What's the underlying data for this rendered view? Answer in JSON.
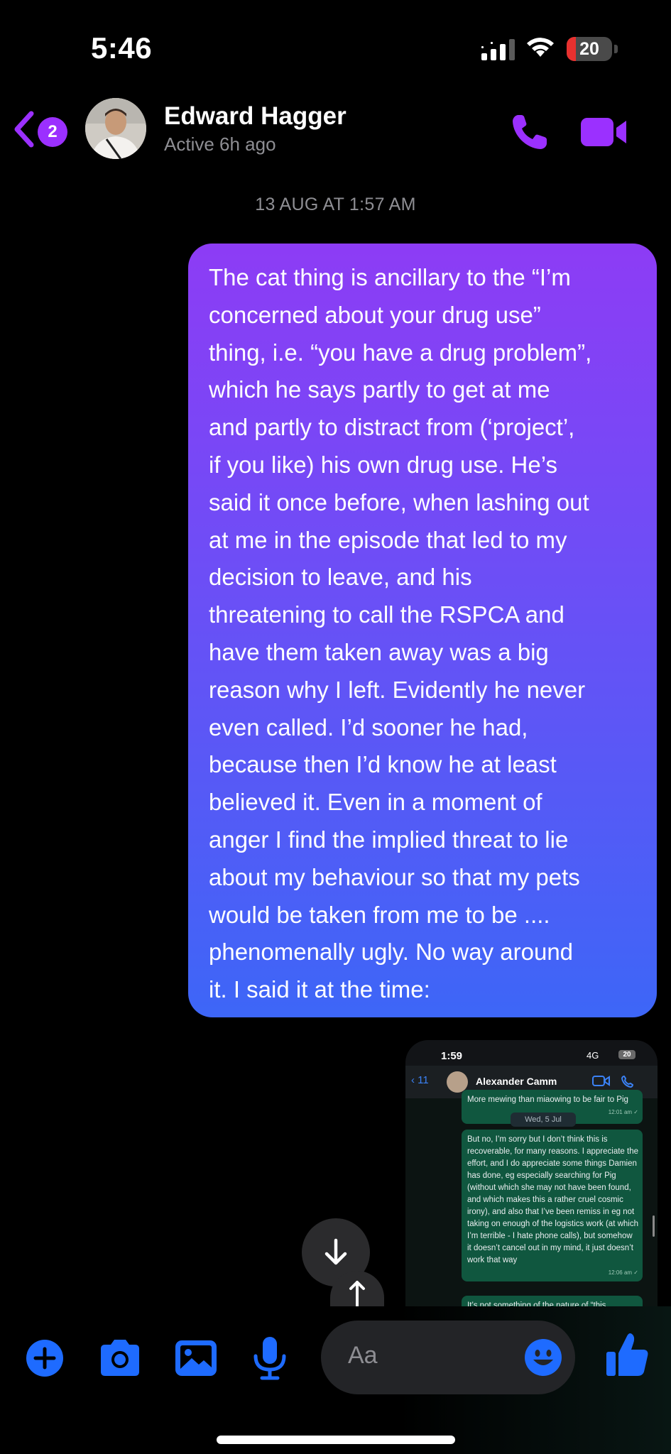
{
  "status_bar": {
    "time": "5:46",
    "battery_level": "20",
    "battery_fraction": 0.2,
    "battery_color": "#e8312f"
  },
  "header": {
    "unread_count": "2",
    "contact_name": "Edward Hagger",
    "contact_status": "Active 6h ago",
    "accent_color": "#9b30ff"
  },
  "conversation": {
    "timestamp": "13 AUG AT 1:57 AM",
    "message_text": "The cat thing is ancillary to the “I’m\nconcerned about your drug use”\nthing, i.e. “you have a drug problem”,\nwhich he says partly to get at me\nand partly to distract from (‘project’,\nif you like) his own drug use. He’s\nsaid it once before, when lashing out\nat me in the episode that led to my\ndecision to leave, and his\nthreatening to call the RSPCA and\nhave them taken away was a big\nreason why I left. Evidently he never\neven called. I’d sooner he had,\nbecause then I’d know he at least\nbelieved it. Even in a moment of\nanger I find the implied threat to lie\nabout my behaviour so that my pets\nwould be taken from me to be ....\nphenomenally ugly. No way around\nit. I said it at the time:",
    "attachment": {
      "time": "1:59",
      "network": "4G",
      "battery": "20",
      "back_count": "11",
      "contact_name": "Alexander Camm",
      "top_snippet": "More mewing than miaowing to be fair to Pig",
      "date_chip": "Wed, 5 Jul",
      "bubble1_time": "12:01 am ✓",
      "bubble2_text": "But no, I’m sorry but I don’t think this is recoverable, for many reasons. I appreciate the effort, and I do appreciate some things Damien has done, eg especially searching for Pig (without which she may not have been found, and which makes this a rather cruel cosmic irony), and also that I’ve been remiss in eg not taking on enough of the logistics work (at which I’m terrible - I hate phone calls), but somehow it doesn’t cancel out in my mind, it just doesn’t work that way",
      "bubble2_time": "12:06 am ✓",
      "bubble3_text": "It’s not something of the nature of “this"
    }
  },
  "composer": {
    "placeholder": "Aa",
    "icon_color": "#1e6bff",
    "tools": [
      "plus-icon",
      "camera-icon",
      "gallery-icon",
      "microphone-icon"
    ]
  }
}
